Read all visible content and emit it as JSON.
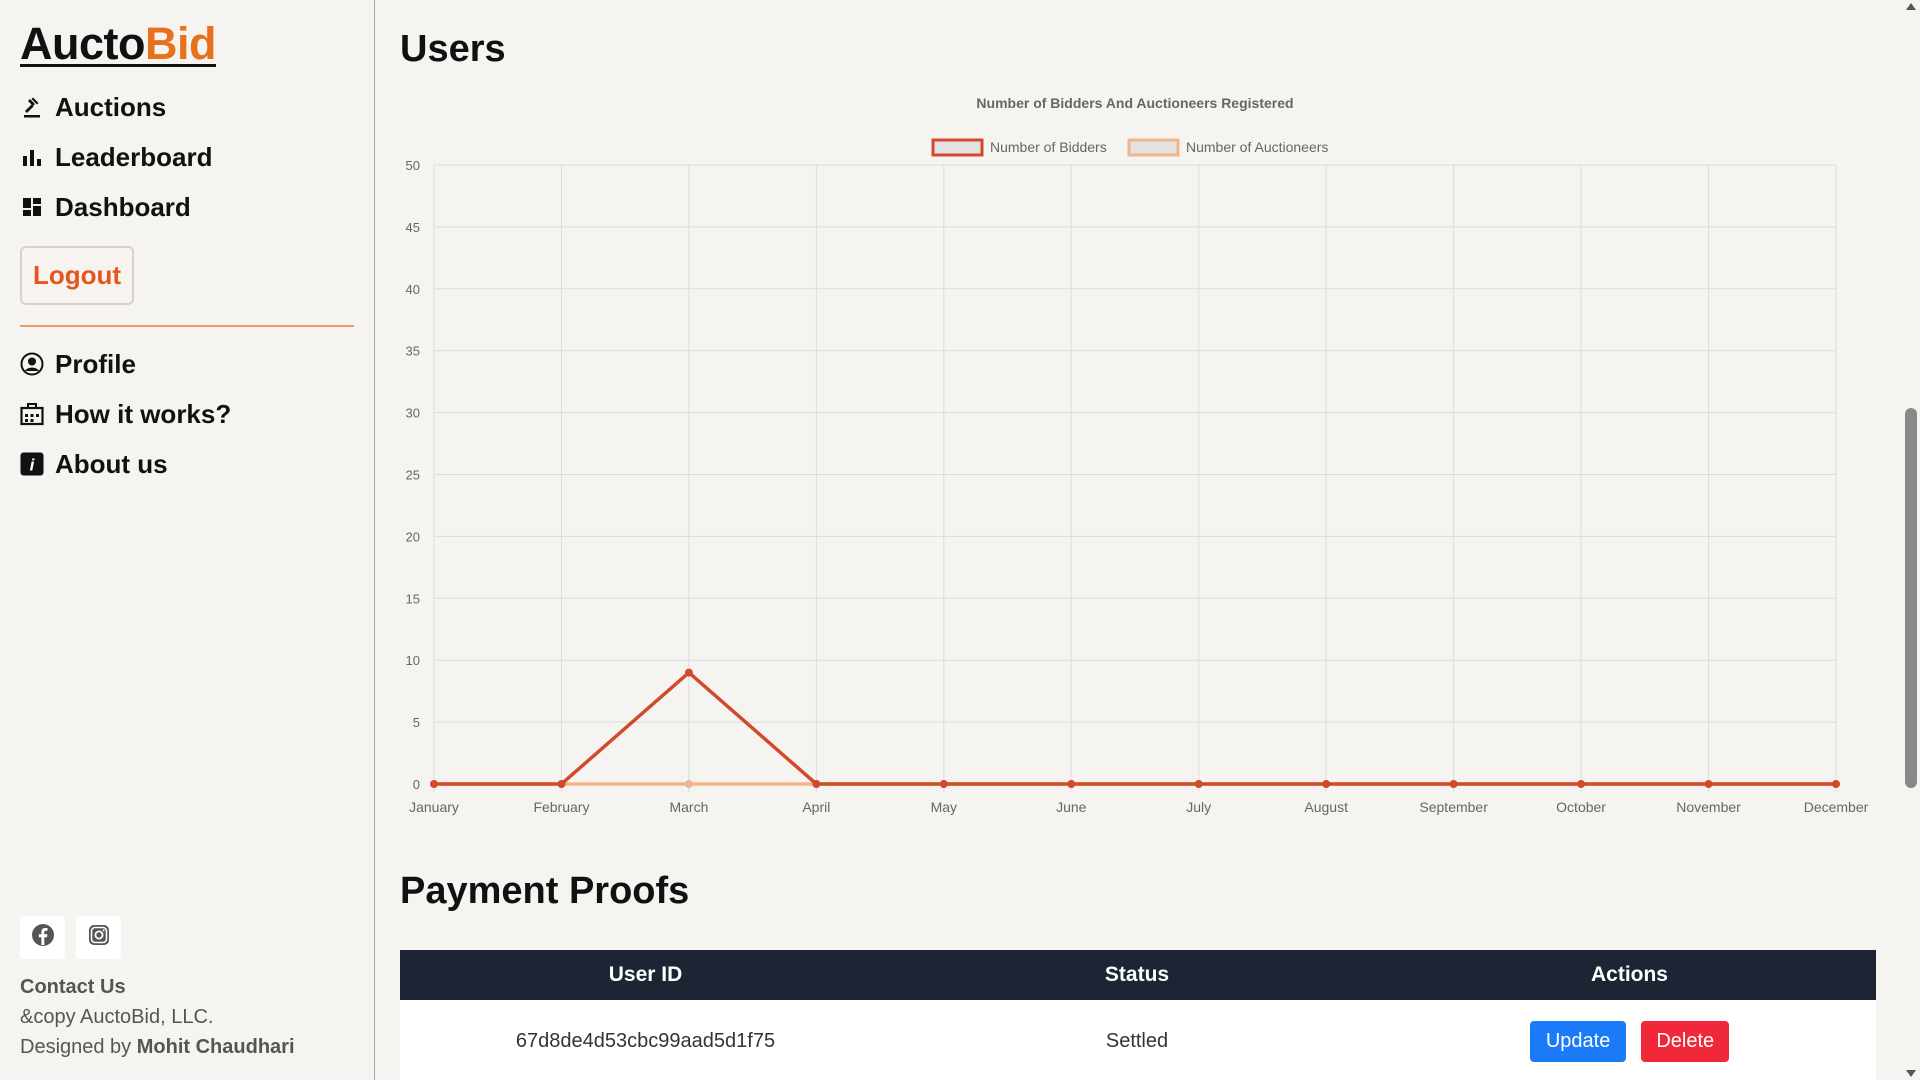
{
  "sidebar": {
    "logo_part1": "Aucto",
    "logo_part2": "Bid",
    "nav": [
      {
        "label": "Auctions",
        "icon": "gavel-icon"
      },
      {
        "label": "Leaderboard",
        "icon": "bar-chart-icon"
      },
      {
        "label": "Dashboard",
        "icon": "dashboard-icon"
      }
    ],
    "logout_label": "Logout",
    "nav2": [
      {
        "label": "Profile",
        "icon": "user-circle-icon"
      },
      {
        "label": "How it works?",
        "icon": "briefcase-icon"
      },
      {
        "label": "About us",
        "icon": "info-icon"
      }
    ],
    "contact_label": "Contact Us",
    "copyright": "&copy AuctoBid, LLC.",
    "designed_by_prefix": "Designed by ",
    "designer": "Mohit Chaudhari"
  },
  "main": {
    "users_heading": "Users",
    "payments_heading": "Payment Proofs"
  },
  "table": {
    "headers": [
      "User ID",
      "Status",
      "Actions"
    ],
    "rows": [
      {
        "user_id": "67d8de4d53cbc99aad5d1f75",
        "status": "Settled",
        "update_label": "Update",
        "delete_label": "Delete"
      }
    ]
  },
  "colors": {
    "accent": "#e8711b",
    "bidders_line": "#d24a2e",
    "auctioneers_line": "#f2b48a",
    "table_header": "#1d2535",
    "update": "#1a7af8",
    "delete": "#f0283a"
  },
  "chart_data": {
    "type": "line",
    "title": "Number of Bidders And Auctioneers Registered",
    "categories": [
      "January",
      "February",
      "March",
      "April",
      "May",
      "June",
      "July",
      "August",
      "September",
      "October",
      "November",
      "December"
    ],
    "series": [
      {
        "name": "Number of Bidders",
        "values": [
          0,
          0,
          9,
          0,
          0,
          0,
          0,
          0,
          0,
          0,
          0,
          0
        ]
      },
      {
        "name": "Number of Auctioneers",
        "values": [
          0,
          0,
          0,
          0,
          0,
          0,
          0,
          0,
          0,
          0,
          0,
          0
        ]
      }
    ],
    "ylim": [
      0,
      50
    ],
    "yticks": [
      0,
      5,
      10,
      15,
      20,
      25,
      30,
      35,
      40,
      45,
      50
    ],
    "grid": true,
    "legend": "top-center"
  }
}
